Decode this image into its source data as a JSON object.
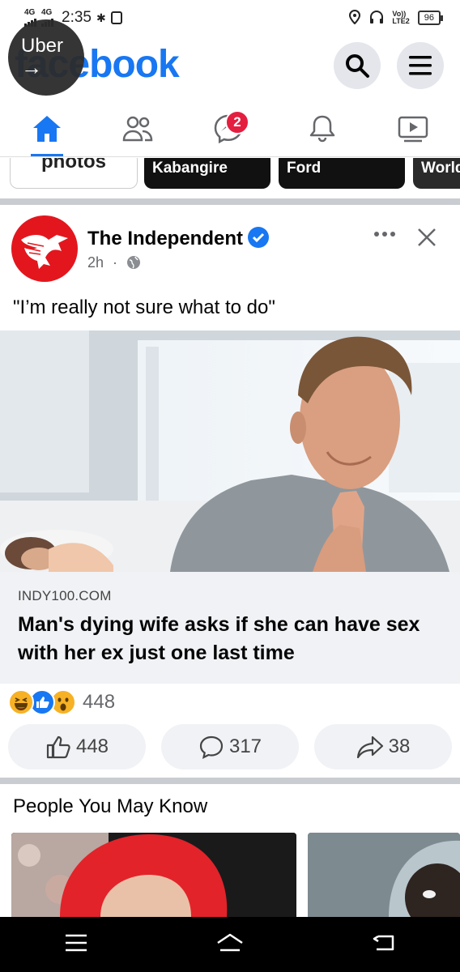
{
  "status_bar": {
    "network1": "4G",
    "network2": "4G",
    "time": "2:35",
    "volte": "Vo))",
    "lte": "LTE2",
    "battery": "96"
  },
  "header": {
    "logo": "facebook",
    "search_icon": "search-icon",
    "menu_icon": "menu-icon"
  },
  "uber_bubble": {
    "label": "Uber",
    "arrow": "→"
  },
  "nav": {
    "messenger_badge": "2",
    "items": [
      "home-icon",
      "friends-icon",
      "messenger-icon",
      "notifications-icon",
      "watch-icon"
    ]
  },
  "story_chips": [
    {
      "label": "photos"
    },
    {
      "label": "Kabangire"
    },
    {
      "label": "Ford"
    },
    {
      "label": "World"
    }
  ],
  "post": {
    "page_name": "The Independent",
    "time": "2h",
    "separator": "·",
    "text": "\"I’m really not sure what to do\"",
    "link_domain": "INDY100.COM",
    "link_title": "Man's dying wife asks if she can have sex with her ex just one last time",
    "reaction_count": "448",
    "like_count": "448",
    "comment_count": "317",
    "share_count": "38"
  },
  "pymk": {
    "title": "People You May Know"
  },
  "colors": {
    "facebook_blue": "#1877f2",
    "badge_red": "#e41e3f",
    "independent_red": "#e3161e"
  }
}
